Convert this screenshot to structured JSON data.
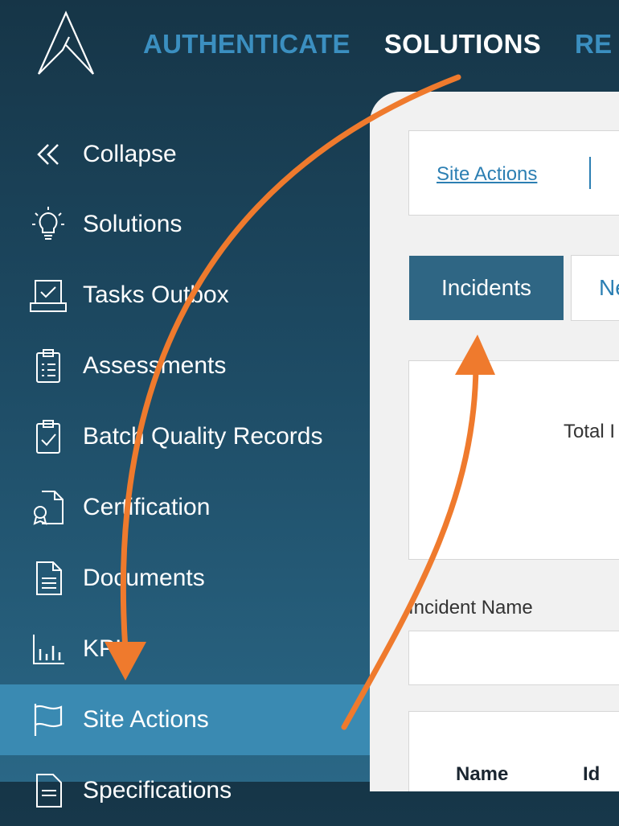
{
  "topnav": {
    "items": [
      "AUTHENTICATE",
      "SOLUTIONS",
      "RE"
    ],
    "active_index": 1
  },
  "sidebar": {
    "items": [
      {
        "label": "Collapse",
        "icon": "chevrons-left-icon"
      },
      {
        "label": "Solutions",
        "icon": "lightbulb-icon"
      },
      {
        "label": "Tasks Outbox",
        "icon": "tray-check-icon"
      },
      {
        "label": "Assessments",
        "icon": "clipboard-list-icon"
      },
      {
        "label": "Batch Quality Records",
        "icon": "clipboard-check-icon"
      },
      {
        "label": "Certification",
        "icon": "certificate-icon"
      },
      {
        "label": "Documents",
        "icon": "document-icon"
      },
      {
        "label": "KPI",
        "icon": "bar-chart-icon"
      },
      {
        "label": "Site Actions",
        "icon": "flag-icon"
      },
      {
        "label": "Specifications",
        "icon": "document-icon"
      }
    ],
    "active_index": 8
  },
  "main": {
    "breadcrumb_link": "Site Actions",
    "tabs": [
      "Incidents",
      "Ne"
    ],
    "summary_label": "Total I",
    "filter_label": "Incident Name",
    "filter_value": "",
    "table_headers": [
      "Name",
      "Id"
    ]
  },
  "colors": {
    "accent": "#3a8ab2",
    "arrow": "#ef7a2d",
    "tab_active": "#2f6684"
  }
}
